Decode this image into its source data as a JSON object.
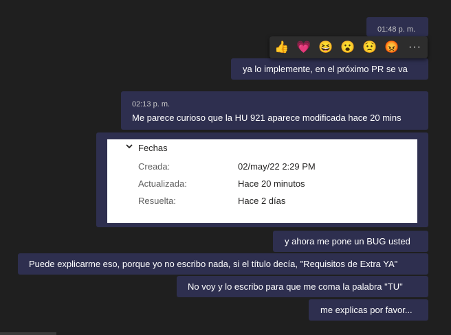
{
  "messages": {
    "m1": {
      "time": "01:48 p. m.",
      "text": "ya lo implemente, en el próximo PR se va"
    },
    "m2": {
      "time": "02:13 p. m.",
      "text": "Me parece curioso que la HU 921 aparece modificada hace 20 mins"
    },
    "m3": {
      "text": "y ahora me pone un BUG usted"
    },
    "m4": {
      "text": "Puede explicarme eso, porque yo no escribo nada, si el título decía, \"Requisitos de Extra YA\""
    },
    "m5": {
      "text": "No voy y lo escribo para que me coma la palabra \"TU\""
    },
    "m6": {
      "text": "me explicas por favor..."
    }
  },
  "reactions": {
    "like": "👍",
    "heart": "💗",
    "laugh": "😆",
    "surprised": "😮",
    "sad": "😟",
    "angry": "😡",
    "more": "···"
  },
  "card": {
    "section": "Fechas",
    "rows": [
      {
        "label": "Creada:",
        "value": "02/may/22 2:29 PM"
      },
      {
        "label": "Actualizada:",
        "value": "Hace 20 minutos"
      },
      {
        "label": "Resuelta:",
        "value": "Hace 2 días"
      }
    ]
  },
  "colors": {
    "background": "#1f1f1f",
    "bubble": "#2e2f4f",
    "card": "#ffffff"
  }
}
